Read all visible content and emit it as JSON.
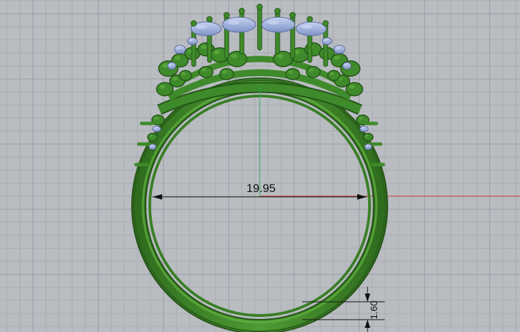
{
  "viewport": {
    "background": "#b9bcc1",
    "grid_minor_color": "#a7abb1",
    "grid_major_color": "#969aa1",
    "x_axis_color": "#c0392b",
    "y_axis_color": "#27ae60"
  },
  "model": {
    "band_color": "#3f8a2a",
    "band_highlight": "#5fae3e",
    "band_shadow": "#245418",
    "gem_color": "#8fa4d8",
    "gem_highlight": "#c5d2f0"
  },
  "dimensions": {
    "inner_diameter_label": "19.95",
    "band_thickness_label": "1.60"
  }
}
